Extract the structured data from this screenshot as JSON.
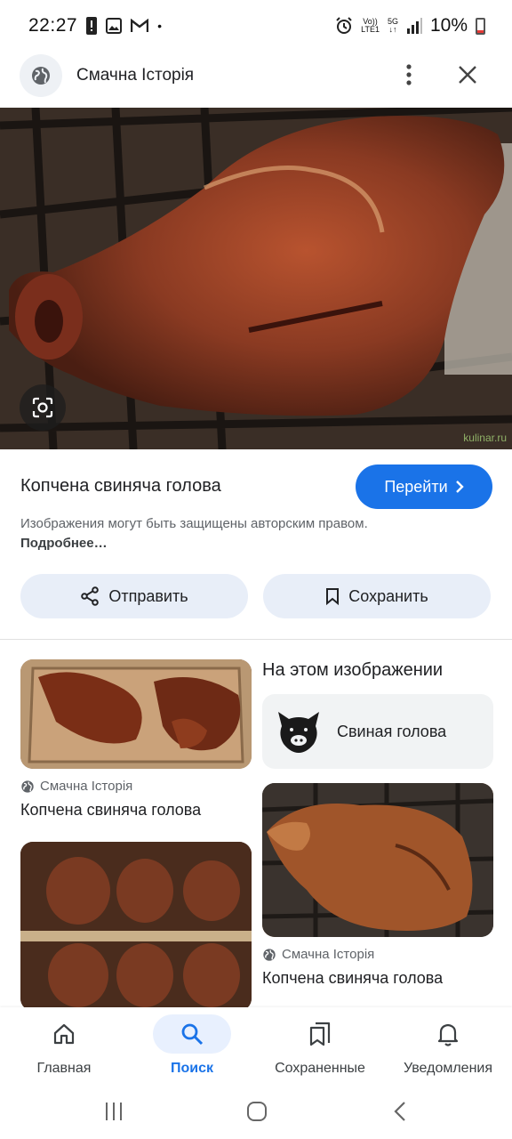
{
  "status_bar": {
    "time": "22:27",
    "volte": "Vo))",
    "lte": "LTE1",
    "network": "5G",
    "battery": "10%"
  },
  "topbar": {
    "site_name": "Смачна Історія"
  },
  "hero": {
    "watermark": "kulinar.ru"
  },
  "result": {
    "title": "Копчена свиняча голова",
    "visit_label": "Перейти",
    "copyright_text": "Изображения могут быть защищены авторским правом.",
    "more_link": "Подробнее…"
  },
  "actions": {
    "share_label": "Отправить",
    "save_label": "Сохранить"
  },
  "entities": {
    "heading": "На этом изображении",
    "items": [
      {
        "label": "Свиная голова",
        "icon": "pig-head-icon"
      }
    ]
  },
  "related": [
    {
      "source": "Смачна Історія",
      "title": "Копчена свиняча голова"
    },
    {
      "source": "Смачна Історія",
      "title": "Копчена свиняча голова"
    }
  ],
  "bottom_nav": {
    "items": [
      {
        "label": "Главная",
        "icon": "home-icon"
      },
      {
        "label": "Поиск",
        "icon": "search-icon",
        "active": true
      },
      {
        "label": "Сохраненные",
        "icon": "bookmarks-icon"
      },
      {
        "label": "Уведомления",
        "icon": "bell-icon"
      }
    ]
  },
  "colors": {
    "accent": "#1a73e8",
    "chip_bg": "#e8eef8"
  }
}
